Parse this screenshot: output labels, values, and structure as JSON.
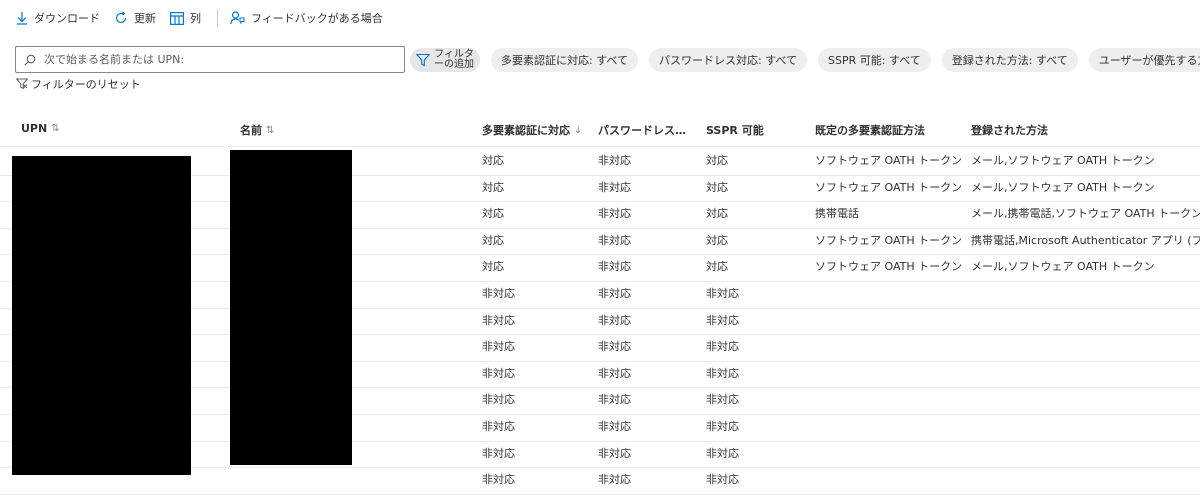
{
  "toolbar": {
    "download": "ダウンロード",
    "refresh": "更新",
    "columns": "列",
    "feedback": "フィードバックがある場合"
  },
  "filters": {
    "search_placeholder": "次で始まる名前または UPN:",
    "add_filter_line1": "フィルタ",
    "add_filter_line2": "ーの追加",
    "pills": [
      "多要素認証に対応: すべて",
      "パスワードレス対応: すべて",
      "SSPR 可能: すべて",
      "登録された方法: すべて",
      "ユーザーが優先する方"
    ],
    "reset": "フィルターのリセット"
  },
  "table": {
    "columns": [
      "UPN",
      "名前",
      "多要素認証に対応",
      "パスワードレス…",
      "SSPR 可能",
      "既定の多要素認証方法",
      "登録された方法"
    ],
    "sort_icons": [
      "⇅",
      "⇅",
      "↓"
    ],
    "rows": [
      [
        "対応",
        "非対応",
        "対応",
        "ソフトウェア OATH トークン",
        "メール,ソフトウェア OATH トークン"
      ],
      [
        "対応",
        "非対応",
        "対応",
        "ソフトウェア OATH トークン",
        "メール,ソフトウェア OATH トークン"
      ],
      [
        "対応",
        "非対応",
        "対応",
        "携帯電話",
        "メール,携帯電話,ソフトウェア OATH トークン"
      ],
      [
        "対応",
        "非対応",
        "対応",
        "ソフトウェア OATH トークン",
        "携帯電話,Microsoft Authenticator アプリ (プッシュ"
      ],
      [
        "対応",
        "非対応",
        "対応",
        "ソフトウェア OATH トークン",
        "メール,ソフトウェア OATH トークン"
      ],
      [
        "非対応",
        "非対応",
        "非対応",
        "",
        ""
      ],
      [
        "非対応",
        "非対応",
        "非対応",
        "",
        ""
      ],
      [
        "非対応",
        "非対応",
        "非対応",
        "",
        ""
      ],
      [
        "非対応",
        "非対応",
        "非対応",
        "",
        ""
      ],
      [
        "非対応",
        "非対応",
        "非対応",
        "",
        ""
      ],
      [
        "非対応",
        "非対応",
        "非対応",
        "",
        ""
      ],
      [
        "非対応",
        "非対応",
        "非対応",
        "",
        ""
      ],
      [
        "非対応",
        "非対応",
        "非対応",
        "",
        ""
      ]
    ]
  },
  "colors": {
    "accent": "#0078d4",
    "pill": "#eeeeee",
    "redaction": "#000000"
  }
}
